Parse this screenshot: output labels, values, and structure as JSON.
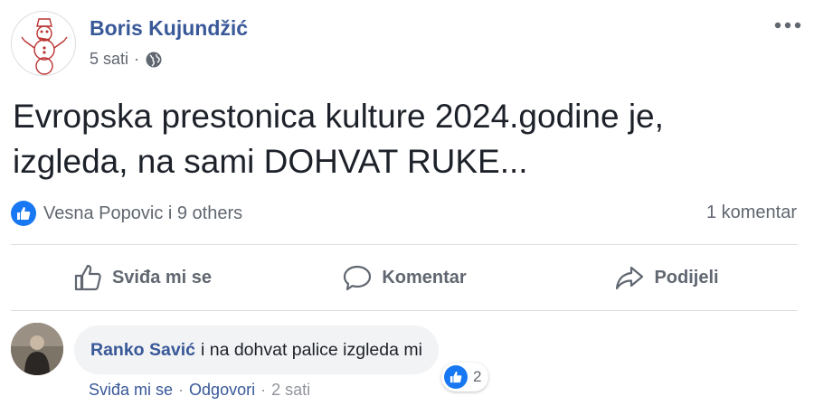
{
  "post": {
    "author": "Boris Kujundžić",
    "time": "5 sati",
    "separator": "·",
    "privacy_icon": "globe-icon",
    "more_icon": "ellipsis-icon",
    "text_line1": "Evropska prestonica kulture 2024.godine je,",
    "text_line2": "izgleda, na sami DOHVAT RUKE..."
  },
  "reactions": {
    "icon": "like-icon",
    "summary": "Vesna Popovic i 9 others",
    "comment_count": "1 komentar"
  },
  "actions": {
    "like_label": "Sviđa mi se",
    "comment_label": "Komentar",
    "share_label": "Podijeli"
  },
  "comment": {
    "author": "Ranko Savić",
    "text": "i na dohvat palice izgleda mi",
    "reaction_count": "2",
    "like_label": "Sviđa mi se",
    "reply_label": "Odgovori",
    "time": "2 sati",
    "separator": "·"
  },
  "colors": {
    "link": "#385898",
    "like_blue": "#1877f2",
    "muted": "#606770",
    "bubble": "#f2f3f5"
  }
}
